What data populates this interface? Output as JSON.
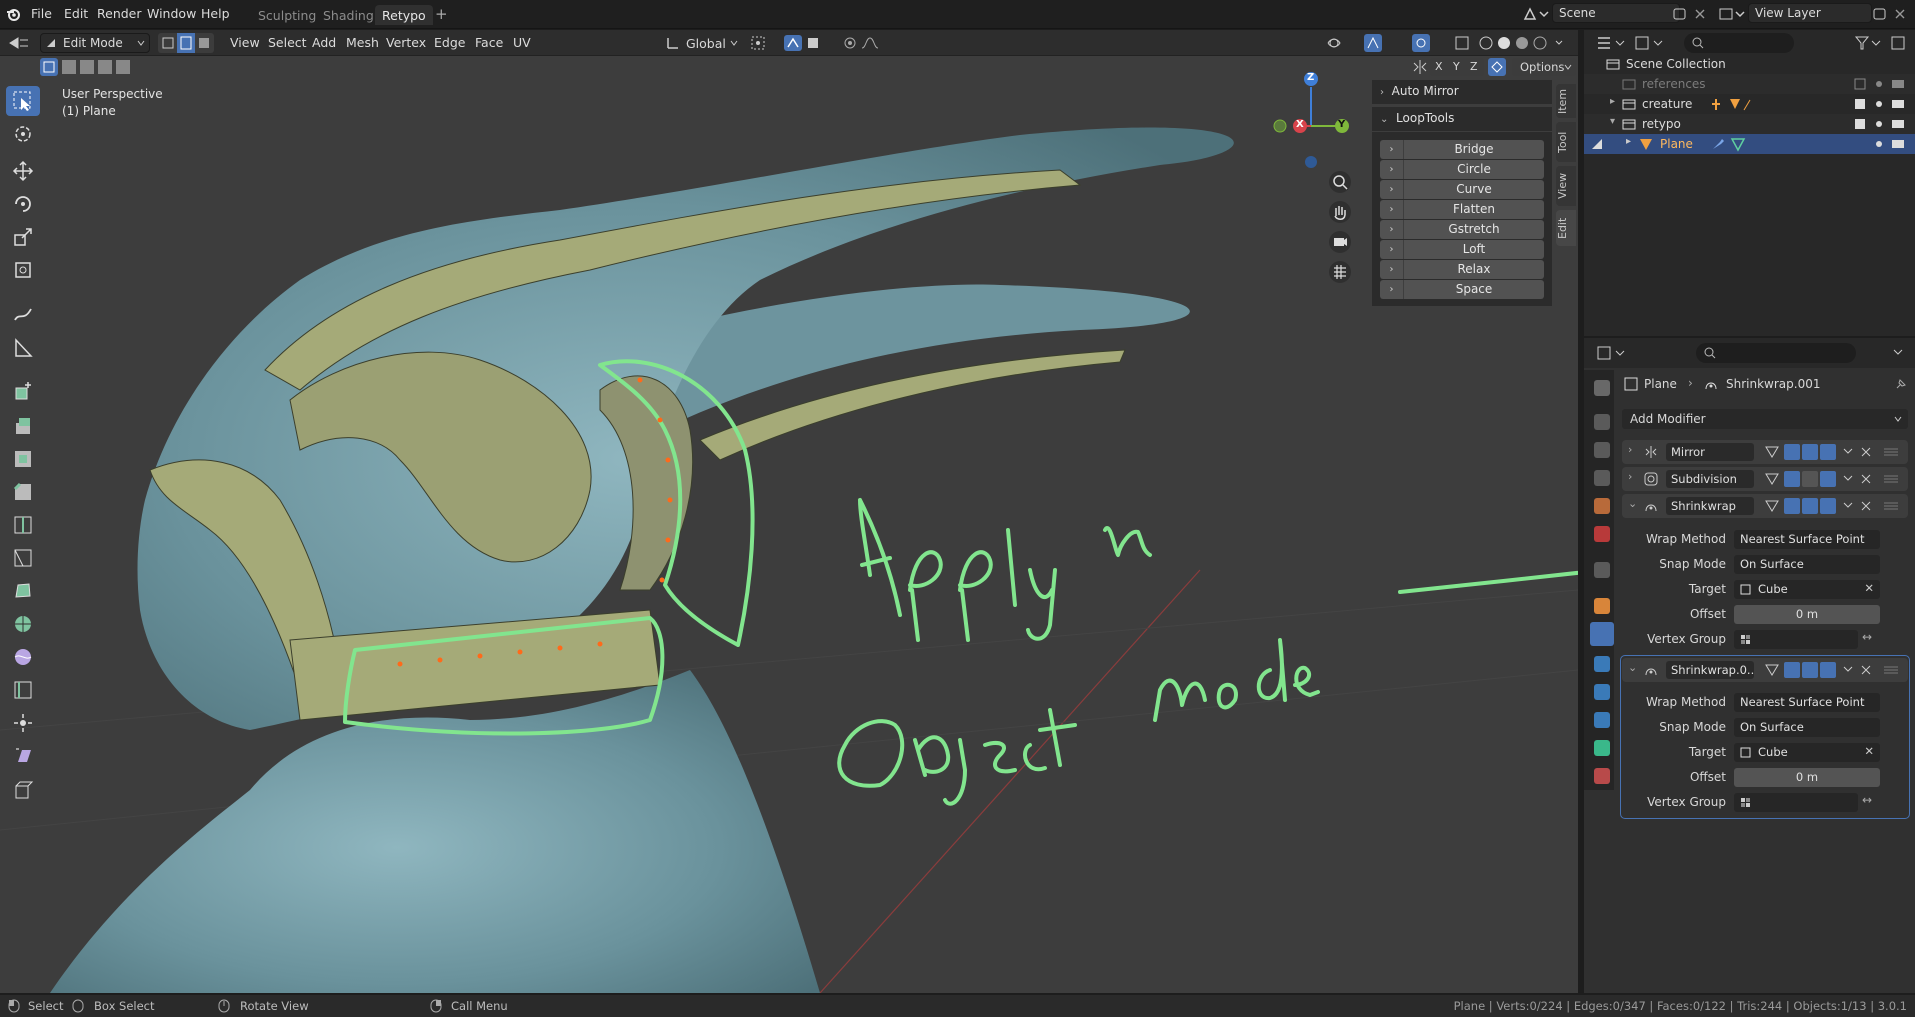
{
  "topbar": {
    "menus": [
      "File",
      "Edit",
      "Render",
      "Window",
      "Help"
    ],
    "workspace_tabs": [
      "Sculpting",
      "Shading",
      "Retypo"
    ],
    "active_tab": "Retypo",
    "add_tab": "+",
    "scene_label": "Scene",
    "view_layer_label": "View Layer"
  },
  "viewport_header": {
    "mode": "Edit Mode",
    "menus": [
      "View",
      "Select",
      "Add",
      "Mesh",
      "Vertex",
      "Edge",
      "Face",
      "UV"
    ],
    "transform_orientation": "Global",
    "axis_labels": [
      "X",
      "Y",
      "Z"
    ],
    "options_label": "Options"
  },
  "viewport": {
    "perspective_label": "User Perspective",
    "object_label": "(1) Plane",
    "gizmo_labels": {
      "z": "Z",
      "x": "X",
      "y": "Y"
    },
    "annotation_text_line1": "Apply in",
    "annotation_text_line2": "Object mode",
    "colors": {
      "background": "#3d3d3d",
      "mesh": "#6f98a3",
      "retopo": "#a7ac7a",
      "annotation": "#82e58e"
    }
  },
  "npanel": {
    "auto_mirror": "Auto Mirror",
    "looptools": "LoopTools",
    "looptools_items": [
      "Bridge",
      "Circle",
      "Curve",
      "Flatten",
      "Gstretch",
      "Loft",
      "Relax",
      "Space"
    ],
    "tabs": [
      "Item",
      "Tool",
      "View",
      "Edit"
    ]
  },
  "outliner": {
    "title": "Scene Collection",
    "items": [
      {
        "label": "references",
        "muted": true
      },
      {
        "label": "creature",
        "muted": false
      },
      {
        "label": "retypo",
        "muted": false
      },
      {
        "label": "Plane",
        "selected": true
      }
    ]
  },
  "properties": {
    "breadcrumb_object": "Plane",
    "breadcrumb_modifier": "Shrinkwrap.001",
    "add_modifier": "Add Modifier",
    "modifiers": [
      {
        "name": "Mirror",
        "expanded": false
      },
      {
        "name": "Subdivision",
        "expanded": false
      },
      {
        "name": "Shrinkwrap",
        "expanded": true,
        "wrap_method_label": "Wrap Method",
        "wrap_method": "Nearest Surface Point",
        "snap_mode_label": "Snap Mode",
        "snap_mode": "On Surface",
        "target_label": "Target",
        "target": "Cube",
        "offset_label": "Offset",
        "offset": "0 m",
        "vertex_group_label": "Vertex Group"
      },
      {
        "name": "Shrinkwrap.0...",
        "expanded": true,
        "wrap_method_label": "Wrap Method",
        "wrap_method": "Nearest Surface Point",
        "snap_mode_label": "Snap Mode",
        "snap_mode": "On Surface",
        "target_label": "Target",
        "target": "Cube",
        "offset_label": "Offset",
        "offset": "0 m",
        "vertex_group_label": "Vertex Group"
      }
    ]
  },
  "statusbar": {
    "select": "Select",
    "box_select": "Box Select",
    "rotate_view": "Rotate View",
    "call_menu": "Call Menu",
    "stats": "Plane | Verts:0/224 | Edges:0/347 | Faces:0/122 | Tris:244 | Objects:1/13 | 3.0.1"
  }
}
